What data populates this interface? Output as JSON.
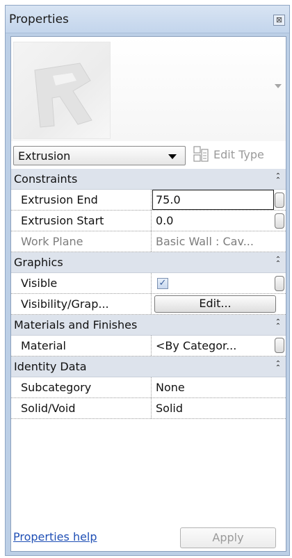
{
  "panel": {
    "title": "Properties",
    "close_symbol": "⊠"
  },
  "preview": {
    "icon": "revit-logo-preview"
  },
  "type_selector": {
    "value": "Extrusion"
  },
  "edit_type": {
    "label": "Edit Type",
    "icon": "edit-type-icon"
  },
  "groups": {
    "constraints": {
      "label": "Constraints",
      "rows": {
        "extrusion_end": {
          "name": "Extrusion End",
          "value": "75.0"
        },
        "extrusion_start": {
          "name": "Extrusion Start",
          "value": "0.0"
        },
        "work_plane": {
          "name": "Work Plane",
          "value": "Basic Wall : Cav..."
        }
      }
    },
    "graphics": {
      "label": "Graphics",
      "rows": {
        "visible": {
          "name": "Visible",
          "checked": true,
          "check_mark": "✓"
        },
        "visibility": {
          "name": "Visibility/Grap...",
          "button": "Edit..."
        }
      }
    },
    "materials": {
      "label": "Materials and Finishes",
      "rows": {
        "material": {
          "name": "Material",
          "value": "<By Categor..."
        }
      }
    },
    "identity": {
      "label": "Identity Data",
      "rows": {
        "subcategory": {
          "name": "Subcategory",
          "value": "None"
        },
        "solid_void": {
          "name": "Solid/Void",
          "value": "Solid"
        }
      }
    }
  },
  "footer": {
    "help_link": "Properties help",
    "apply_button": "Apply"
  },
  "colors": {
    "frame": "#bccfe6",
    "group_header": "#dde3ec",
    "link": "#1f4fb5",
    "disabled_text": "#7d7d7d"
  }
}
